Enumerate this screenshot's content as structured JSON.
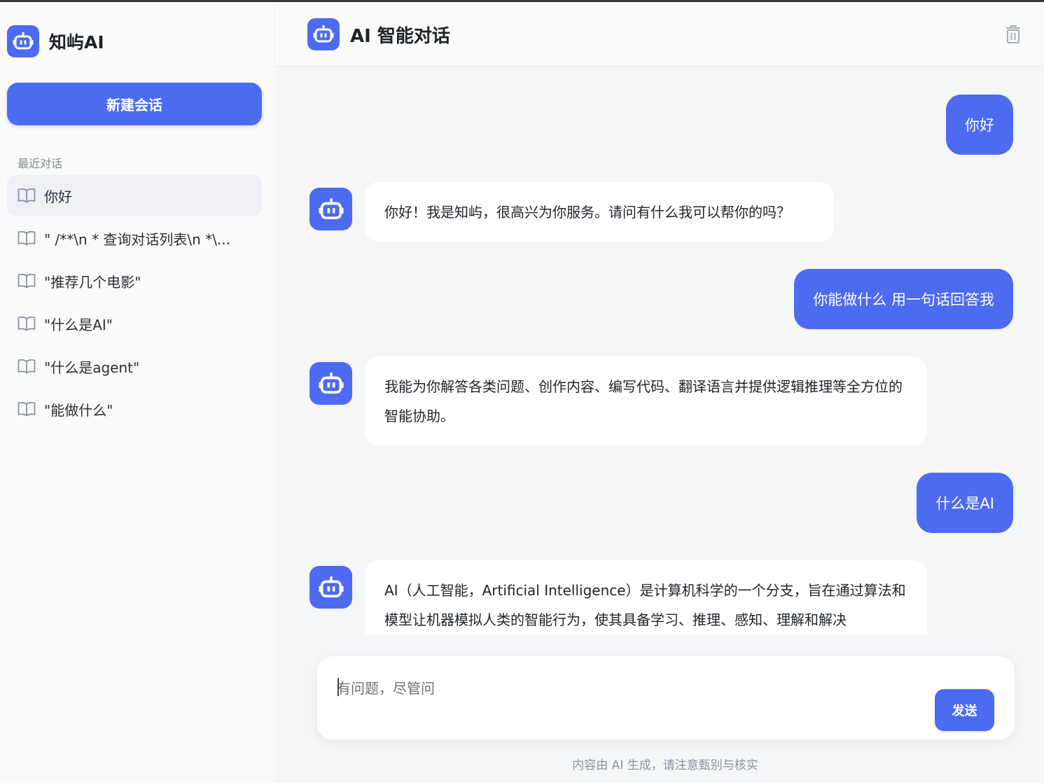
{
  "brand": {
    "name": "知屿AI",
    "logo_icon": "robot-icon"
  },
  "sidebar": {
    "new_chat_label": "新建会话",
    "section_label": "最近对话",
    "conversations": [
      {
        "label": "你好",
        "icon": "book-icon",
        "active": true
      },
      {
        "label": "\" /**\\n * 查询对话列表\\n *\\...",
        "icon": "book-icon"
      },
      {
        "label": "\"推荐几个电影\"",
        "icon": "book-icon"
      },
      {
        "label": "\"什么是AI\"",
        "icon": "book-icon"
      },
      {
        "label": "\"什么是agent\"",
        "icon": "book-icon"
      },
      {
        "label": "\"能做什么\"",
        "icon": "book-icon"
      }
    ]
  },
  "header": {
    "title": "AI 智能对话",
    "clear_icon": "trash-icon"
  },
  "messages": [
    {
      "role": "user",
      "text": "你好"
    },
    {
      "role": "assistant",
      "text": "你好！我是知屿，很高兴为你服务。请问有什么我可以帮你的吗？"
    },
    {
      "role": "user",
      "text": "你能做什么 用一句话回答我"
    },
    {
      "role": "assistant",
      "text": "我能为你解答各类问题、创作内容、编写代码、翻译语言并提供逻辑推理等全方位的智能协助。"
    },
    {
      "role": "user",
      "text": "什么是AI"
    },
    {
      "role": "assistant",
      "text": "AI（人工智能，Artificial Intelligence）是计算机科学的一个分支，旨在通过算法和模型让机器模拟人类的智能行为，使其具备学习、推理、感知、理解和解决"
    }
  ],
  "composer": {
    "placeholder": "有问题，尽管问",
    "value": "",
    "send_label": "发送"
  },
  "footer_note": "内容由 AI 生成，请注意甄别与核实",
  "colors": {
    "accent": "#4d6bf0",
    "background": "#f5f6f8",
    "sidebar": "#fafafb"
  }
}
